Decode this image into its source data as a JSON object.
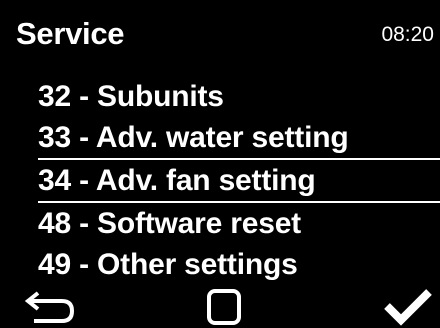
{
  "header": {
    "title": "Service",
    "time": "08:20"
  },
  "menu": {
    "items": [
      {
        "label": "32 - Subunits",
        "selected": false
      },
      {
        "label": "33 - Adv. water setting",
        "selected": false
      },
      {
        "label": "34 - Adv. fan setting",
        "selected": true
      },
      {
        "label": "48 - Software reset",
        "selected": false
      },
      {
        "label": "49 - Other settings",
        "selected": false
      }
    ]
  },
  "footer": {
    "buttons": [
      {
        "icon": "back-arrow-icon"
      },
      {
        "icon": "square-icon"
      },
      {
        "icon": "checkmark-icon"
      }
    ]
  },
  "colors": {
    "background": "#000000",
    "foreground": "#ffffff"
  }
}
